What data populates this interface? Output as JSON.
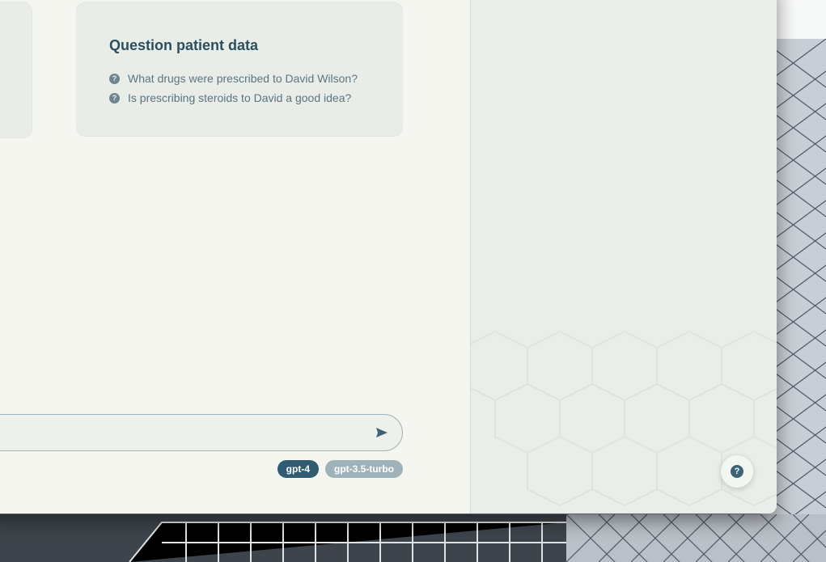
{
  "background": {
    "description_colors": {
      "frame": "#5d6670",
      "glass": "#c9ced4"
    }
  },
  "suggestions": {
    "title": "Question patient data",
    "items": [
      {
        "icon": "question-icon",
        "label": "What drugs were prescribed to David Wilson?"
      },
      {
        "icon": "question-icon",
        "label": "Is prescribing steroids to David a good idea?"
      }
    ]
  },
  "chat_input": {
    "value": "",
    "placeholder": "",
    "send_icon": "send-icon"
  },
  "models": {
    "options": [
      "gpt-4",
      "gpt-3.5-turbo"
    ],
    "selected": "gpt-4"
  },
  "help": {
    "icon": "help-icon",
    "glyph": "?"
  },
  "colors": {
    "accent": "#2f5b73",
    "tag_inactive": "#9eb2ba",
    "page_bg": "#f5f6f0",
    "side_bg": "#e9eeea",
    "card_bg": "#e8ede8"
  }
}
